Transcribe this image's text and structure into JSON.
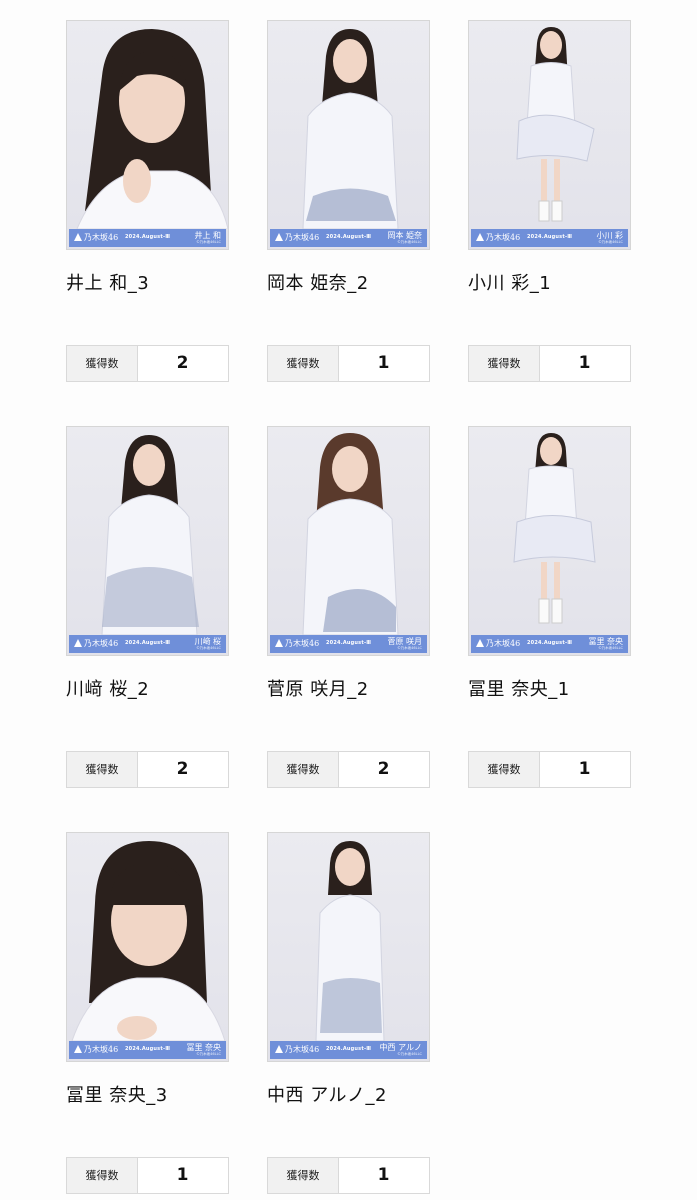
{
  "count_label": "獲得数",
  "photo_brand": "乃木坂46",
  "photo_date": "2024.August-Ⅲ",
  "photo_copyright": "©乃木坂46LLC",
  "colors": {
    "footer_band": "#6f8fd9",
    "border": "#d9d9d9",
    "label_bg": "#f1f1f1"
  },
  "cards": [
    {
      "title": "井上 和_3",
      "photo_name": "井上 和",
      "count": "2",
      "shot": "close-up"
    },
    {
      "title": "岡本 姫奈_2",
      "photo_name": "岡本 姫奈",
      "count": "1",
      "shot": "half-body"
    },
    {
      "title": "小川 彩_1",
      "photo_name": "小川 彩",
      "count": "1",
      "shot": "full-body"
    },
    {
      "title": "川﨑 桜_2",
      "photo_name": "川﨑 桜",
      "count": "2",
      "shot": "half-body"
    },
    {
      "title": "菅原 咲月_2",
      "photo_name": "菅原 咲月",
      "count": "2",
      "shot": "half-body"
    },
    {
      "title": "冨里 奈央_1",
      "photo_name": "冨里 奈央",
      "count": "1",
      "shot": "full-body"
    },
    {
      "title": "冨里 奈央_3",
      "photo_name": "冨里 奈央",
      "count": "1",
      "shot": "close-up"
    },
    {
      "title": "中西 アルノ_2",
      "photo_name": "中西 アルノ",
      "count": "1",
      "shot": "half-body"
    }
  ]
}
